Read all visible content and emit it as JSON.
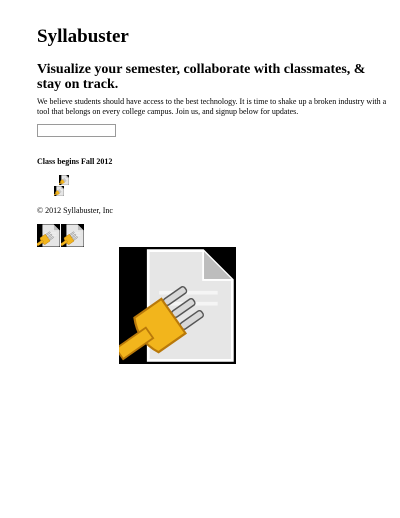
{
  "site": {
    "title": "Syllabuster"
  },
  "hero": {
    "headline": "Visualize your semester, collaborate with classmates, & stay on track.",
    "intro": "We believe students should have access to the best technology. It is time to shake up a broken industry with a tool that belongs on every college campus. Join us, and signup below for updates."
  },
  "signup": {
    "email_value": "",
    "placeholder": ""
  },
  "notice": {
    "class_begins": "Class begins Fall 2012"
  },
  "footer": {
    "copyright": "© 2012 Syllabuster, Inc"
  },
  "icons": {
    "missing_plugin": "missing-plugin-icon"
  },
  "colors": {
    "document_fill": "#e6e6e6",
    "document_shade": "#bdbdbd",
    "icon_background": "#000000",
    "plug_gold": "#f2b51c",
    "plug_gold_dark": "#b9790a",
    "plug_prong": "#d8d8d8"
  }
}
